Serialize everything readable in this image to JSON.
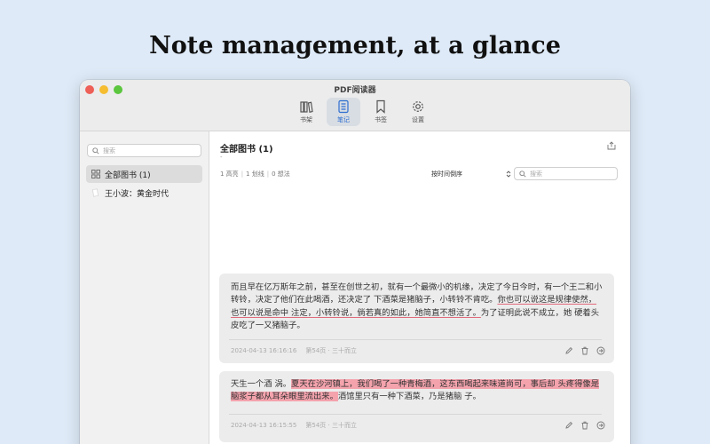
{
  "headline": "Note management, at a glance",
  "window": {
    "title": "PDF阅读器"
  },
  "toolbar": {
    "tabs": [
      {
        "label": "书架",
        "icon": "books-icon"
      },
      {
        "label": "笔记",
        "icon": "note-icon",
        "active": true
      },
      {
        "label": "书签",
        "icon": "bookmark-icon"
      },
      {
        "label": "设置",
        "icon": "gear-icon"
      }
    ]
  },
  "sidebar": {
    "search_placeholder": "搜索",
    "items": [
      {
        "label": "全部图书 (1)",
        "icon": "grid-icon",
        "selected": true
      },
      {
        "label": "王小波：黄金时代",
        "icon": "book-icon",
        "selected": false
      }
    ]
  },
  "main": {
    "title": "全部图书 (1)",
    "subtitle": "-",
    "stats": {
      "highlights": "1 高亮",
      "underlines": "1 划线",
      "thoughts": "0 想法"
    },
    "sort_label": "按时间倒序",
    "search_placeholder": "搜索"
  },
  "notes": [
    {
      "segments": [
        {
          "text": "而且早在亿万斯年之前，甚至在创世之初，就有一个最微小的机缘，决定了今日今时，有一个王二和小转铃，决定了他们在此喝酒，还决定了 下酒菜是猪脑子，小转铃不肯吃。",
          "style": "plain"
        },
        {
          "text": "你也可以说这是规律使然，也可以说是命中 注定，小转铃说，倘若真的如此，她简直不想活了。",
          "style": "underline"
        },
        {
          "text": "为了证明此说不成立，她 硬着头皮吃了一又猪脑子。",
          "style": "plain"
        }
      ],
      "date": "2024-04-13 16:16:16",
      "location": "第54页 · 三十而立"
    },
    {
      "segments": [
        {
          "text": "天生一个酒 涡。",
          "style": "plain"
        },
        {
          "text": "夏天在沙河镇上，我们喝了一种青梅酒，这东西喝起来味道尚可，事后却 头疼得像是脑浆子都从耳朵眼里流出来。",
          "style": "highlight"
        },
        {
          "text": "酒馆里只有一种下酒菜，乃是猪脑 子。",
          "style": "plain"
        }
      ],
      "date": "2024-04-13 16:15:55",
      "location": "第54页 · 三十而立"
    }
  ],
  "colors": {
    "background": "#deeaf7",
    "accent": "#2f6fd0",
    "highlight": "#f4a3ad",
    "underline": "#e06a7a"
  }
}
